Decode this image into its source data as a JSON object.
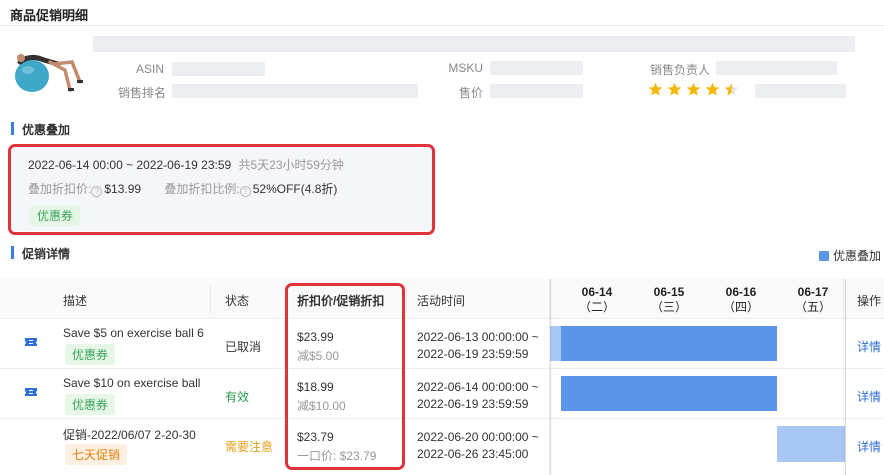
{
  "page": {
    "title": "商品促销明细"
  },
  "product": {
    "asin_label": "ASIN",
    "msku_label": "MSKU",
    "owner_label": "销售负责人",
    "rank_label": "销售排名",
    "price_label": "售价",
    "rating": 4.5,
    "rating_max": 5
  },
  "stacking": {
    "section_title": "优惠叠加",
    "date_range": "2022-06-14 00:00 ~ 2022-06-19 23:59",
    "duration": "共5天23小时59分钟",
    "stack_price_label": "叠加折扣价:",
    "stack_price_value": "$13.99",
    "stack_ratio_label": "叠加折扣比例:",
    "stack_ratio_value": "52%OFF(4.8折)",
    "tag": "优惠券"
  },
  "details": {
    "section_title": "促销详情",
    "legend_label": "优惠叠加",
    "columns": {
      "desc": "描述",
      "status": "状态",
      "price": "折扣价/促销折扣",
      "time": "活动时间",
      "action": "操作"
    },
    "dates": [
      {
        "date": "06-14",
        "weekday": "（二）"
      },
      {
        "date": "06-15",
        "weekday": "（三）"
      },
      {
        "date": "06-16",
        "weekday": "（四）"
      },
      {
        "date": "06-17",
        "weekday": "（五）"
      }
    ],
    "rows": [
      {
        "title": "Save $5 on exercise ball 6",
        "tag": "优惠券",
        "status": "已取消",
        "price": "$23.99",
        "discount": "减$5.00",
        "start": "2022-06-13 00:00:00 ~",
        "end": "2022-06-19 23:59:59",
        "action": "详情"
      },
      {
        "title": "Save $10 on exercise ball",
        "tag": "优惠券",
        "status": "有效",
        "price": "$18.99",
        "discount": "减$10.00",
        "start": "2022-06-14 00:00:00 ~",
        "end": "2022-06-19 23:59:59",
        "action": "详情"
      },
      {
        "title": "促销-2022/06/07 2-20-30",
        "tag": "七天促销",
        "status": "需要注意",
        "price": "$23.79",
        "discount": "一口价: $23.79",
        "start": "2022-06-20 00:00:00 ~",
        "end": "2022-06-26 23:45:00",
        "action": "详情"
      }
    ]
  },
  "colors": {
    "accent": "#3b7fe6",
    "bar": "#5b95ea",
    "highlight_border": "#e0343a",
    "valid": "#2d9a4e",
    "warning": "#e4a01b"
  }
}
